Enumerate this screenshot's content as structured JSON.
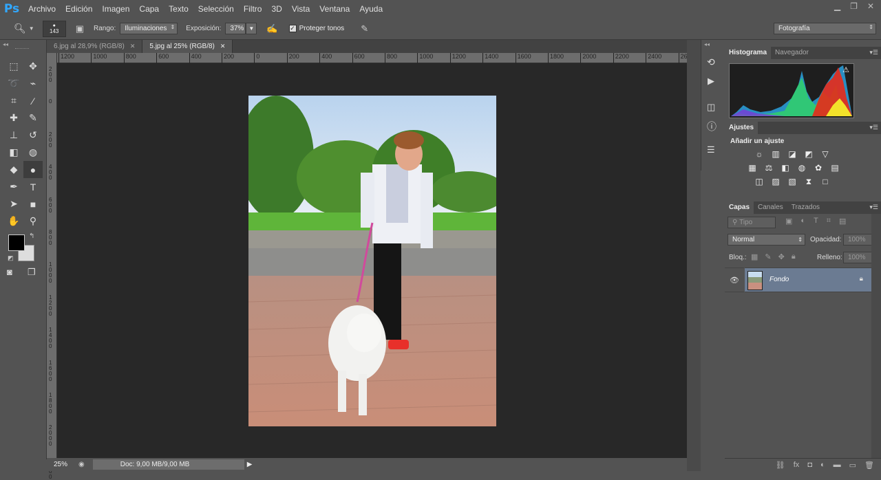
{
  "app": {
    "logo": "Ps"
  },
  "menubar": {
    "items": [
      "Archivo",
      "Edición",
      "Imagen",
      "Capa",
      "Texto",
      "Selección",
      "Filtro",
      "3D",
      "Vista",
      "Ventana",
      "Ayuda"
    ]
  },
  "options": {
    "brush_size": "143",
    "rango_label": "Rango:",
    "rango_value": "Iluminaciones",
    "exposicion_label": "Exposición:",
    "exposicion_value": "37%",
    "proteger_label": "Proteger tonos",
    "workspace": "Fotografía"
  },
  "tabs": [
    {
      "label": "6.jpg al 28,9% (RGB/8)",
      "active": false
    },
    {
      "label": "5.jpg al 25% (RGB/8)",
      "active": true
    }
  ],
  "ruler": {
    "h_labels": [
      "1200",
      "1000",
      "800",
      "600",
      "400",
      "200",
      "0",
      "200",
      "400",
      "600",
      "800",
      "1000",
      "1200",
      "1400",
      "1600",
      "1800",
      "2000",
      "2200",
      "2400",
      "2600"
    ],
    "v_labels": [
      "2\n0\n0",
      "0",
      "2\n0\n0",
      "4\n0\n0",
      "6\n0\n0",
      "8\n0\n0",
      "1\n0\n0\n0",
      "1\n2\n0\n0",
      "1\n4\n0\n0",
      "1\n6\n0\n0",
      "1\n8\n0\n0",
      "2\n0\n0\n0",
      "2\n2\n0\n0"
    ]
  },
  "status": {
    "zoom": "25%",
    "doc": "Doc: 9,00 MB/9,00 MB"
  },
  "histogram_panel": {
    "tabs": [
      "Histograma",
      "Navegador"
    ]
  },
  "adjust_panel": {
    "tab": "Ajustes",
    "title": "Añadir un ajuste"
  },
  "layers_panel": {
    "tabs": [
      "Capas",
      "Canales",
      "Trazados"
    ],
    "filter": "Tipo",
    "blend": "Normal",
    "opacity_label": "Opacidad:",
    "opacity_value": "100%",
    "lock_label": "Bloq.:",
    "fill_label": "Relleno:",
    "fill_value": "100%",
    "layer_name": "Fondo"
  },
  "colors": {
    "accent": "#31a8ff",
    "bg": "#535353",
    "canvas": "#282828",
    "layer_selected": "#6b7b92"
  }
}
